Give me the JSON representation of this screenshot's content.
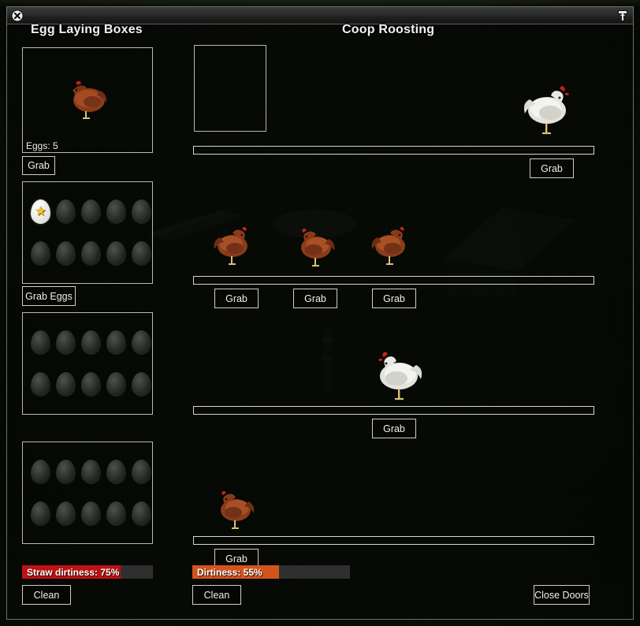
{
  "window": {
    "close_icon": "close-x-icon",
    "pin_icon": "pin-icon"
  },
  "left_panel": {
    "title": "Egg Laying Boxes",
    "boxes": [
      {
        "id": "nest-box-1",
        "type": "occupied-nest",
        "chicken": "brown-hen",
        "eggs_label": "Eggs: 5",
        "egg_count": 5,
        "button": "Grab"
      },
      {
        "id": "nest-box-2",
        "type": "egg-grid",
        "slots": 10,
        "filled": 1,
        "special_egg_icon": "star-icon",
        "button": "Grab Eggs"
      },
      {
        "id": "nest-box-3",
        "type": "egg-grid",
        "slots": 10,
        "filled": 0,
        "button": ""
      },
      {
        "id": "nest-box-4",
        "type": "egg-grid",
        "slots": 10,
        "filled": 0,
        "button": ""
      }
    ],
    "status": {
      "label": "Straw dirtiness: 75%",
      "value": 75,
      "fill_color": "#c01212",
      "track_color": "#2f2f2f",
      "button": "Clean"
    }
  },
  "right_panel": {
    "title": "Coop Roosting",
    "rows": [
      {
        "id": "roost-row-1",
        "chickens": [
          {
            "color": "white",
            "name": "white-hen"
          }
        ],
        "buttons": [
          "Grab"
        ],
        "empty_slot": true
      },
      {
        "id": "roost-row-2",
        "chickens": [
          {
            "color": "brown",
            "name": "brown-hen"
          },
          {
            "color": "brown",
            "name": "brown-hen"
          },
          {
            "color": "brown",
            "name": "brown-hen"
          }
        ],
        "buttons": [
          "Grab",
          "Grab",
          "Grab"
        ]
      },
      {
        "id": "roost-row-3",
        "chickens": [
          {
            "color": "white",
            "name": "white-hen"
          }
        ],
        "buttons": [
          "Grab"
        ]
      },
      {
        "id": "roost-row-4",
        "chickens": [
          {
            "color": "brown",
            "name": "brown-hen"
          }
        ],
        "buttons": [
          "Grab"
        ]
      }
    ],
    "status": {
      "label": "Dirtiness: 55%",
      "value": 55,
      "fill_color": "#d4531c",
      "track_color": "#2f2f2f",
      "button": "Clean"
    },
    "doors_button": "Close Doors"
  }
}
